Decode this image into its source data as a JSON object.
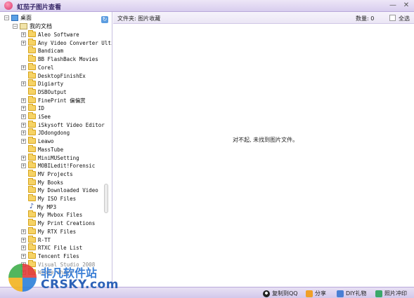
{
  "window": {
    "title": "虹茄子图片查看",
    "minimize": "—",
    "close": "✕"
  },
  "sidebar": {
    "root": "桌面",
    "documents": "我的文档",
    "items": [
      {
        "label": "Aleo Software",
        "expandable": true
      },
      {
        "label": "Any Video Converter Ultim",
        "expandable": true
      },
      {
        "label": "Bandicam",
        "expandable": false
      },
      {
        "label": "BB FlashBack Movies",
        "expandable": false
      },
      {
        "label": "Corel",
        "expandable": true
      },
      {
        "label": "DesktopFinishEx",
        "expandable": false
      },
      {
        "label": "Digiarty",
        "expandable": true
      },
      {
        "label": "DSBOutput",
        "expandable": false
      },
      {
        "label": "FinePrint 偏偏赏",
        "expandable": true
      },
      {
        "label": "ID",
        "expandable": true
      },
      {
        "label": "iSee",
        "expandable": true
      },
      {
        "label": "iSkysoft Video Editor",
        "expandable": true
      },
      {
        "label": "JDdongdong",
        "expandable": true
      },
      {
        "label": "Leawo",
        "expandable": true
      },
      {
        "label": "MassTube",
        "expandable": false
      },
      {
        "label": "MiniMUSetting",
        "expandable": true
      },
      {
        "label": "MOBILedit!Forensic",
        "expandable": true
      },
      {
        "label": "MV Projects",
        "expandable": false
      },
      {
        "label": "My Books",
        "expandable": false
      },
      {
        "label": "My Downloaded Video",
        "expandable": false
      },
      {
        "label": "My ISO Files",
        "expandable": false
      },
      {
        "label": "My MP3",
        "expandable": false,
        "icon": "music-note-icon"
      },
      {
        "label": "My Mvbox Files",
        "expandable": false
      },
      {
        "label": "My Print Creations",
        "expandable": false
      },
      {
        "label": "My RTX Files",
        "expandable": true
      },
      {
        "label": "R-TT",
        "expandable": true
      },
      {
        "label": "RTXC File List",
        "expandable": true
      },
      {
        "label": "Tencent Files",
        "expandable": true
      },
      {
        "label": "Visual Studio 2008",
        "expandable": true,
        "faded": true
      },
      {
        "label": "Wondershare",
        "expandable": true,
        "faded": true
      }
    ]
  },
  "toolbar": {
    "folder_label": "文件夹: 图片收藏",
    "count_label": "数量: 0",
    "select_all": "全选"
  },
  "content": {
    "empty_message": "对不起, 未找到图片文件。"
  },
  "statusbar": {
    "copy_qq": "复制到QQ",
    "share": "分享",
    "diy": "DIY礼物",
    "print": "照片冲印"
  },
  "watermark": {
    "cn": "非凡软件站",
    "en": "CRSKY.com"
  },
  "colors": {
    "accent": "#d8cdee",
    "border": "#b8a8da",
    "folder": "#f6d366"
  }
}
